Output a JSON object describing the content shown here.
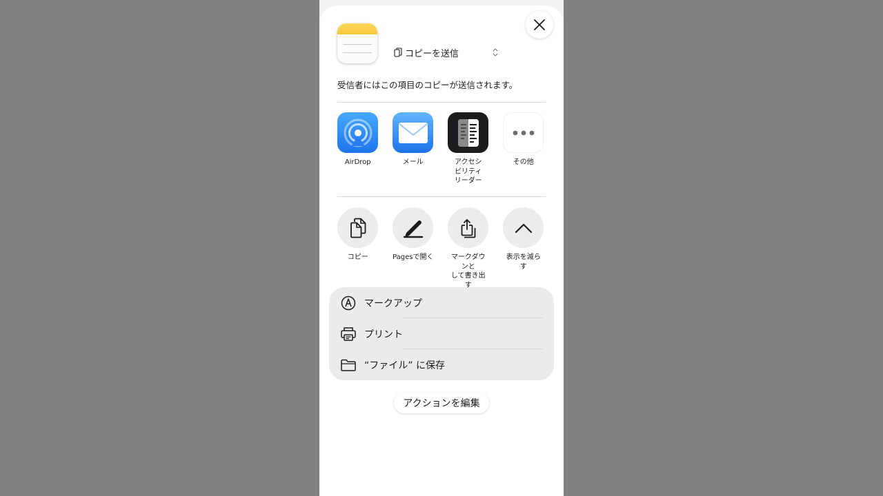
{
  "header": {
    "send_mode_label": "コピーを送信",
    "description": "受信者にはこの項目のコピーが送信されます。"
  },
  "share_targets": [
    {
      "label": "AirDrop",
      "icon": "airdrop-icon"
    },
    {
      "label": "メール",
      "icon": "mail-icon"
    },
    {
      "label": "アクセシ\nビリティ\nリーダー",
      "icon": "accessibility-reader-icon"
    },
    {
      "label": "その他",
      "icon": "more-icon"
    }
  ],
  "actions": [
    {
      "label": "コピー",
      "icon": "copy-icon"
    },
    {
      "label": "Pagesで開く",
      "icon": "pen-icon"
    },
    {
      "label": "マークダウンと\nして書き出す",
      "icon": "export-icon"
    },
    {
      "label": "表示を減らす",
      "icon": "chevron-up-icon"
    }
  ],
  "list": [
    {
      "label": "マークアップ",
      "icon": "markup-icon"
    },
    {
      "label": "プリント",
      "icon": "printer-icon"
    },
    {
      "label": "“ファイル” に保存",
      "icon": "folder-icon"
    }
  ],
  "edit_actions_label": "アクションを編集",
  "colors": {
    "backdrop": "#808080",
    "sheet": "#ffffff",
    "list_bg": "#ebebeb",
    "accent_blue": "#1f74ee",
    "notes_yellow": "#f5c93a"
  }
}
